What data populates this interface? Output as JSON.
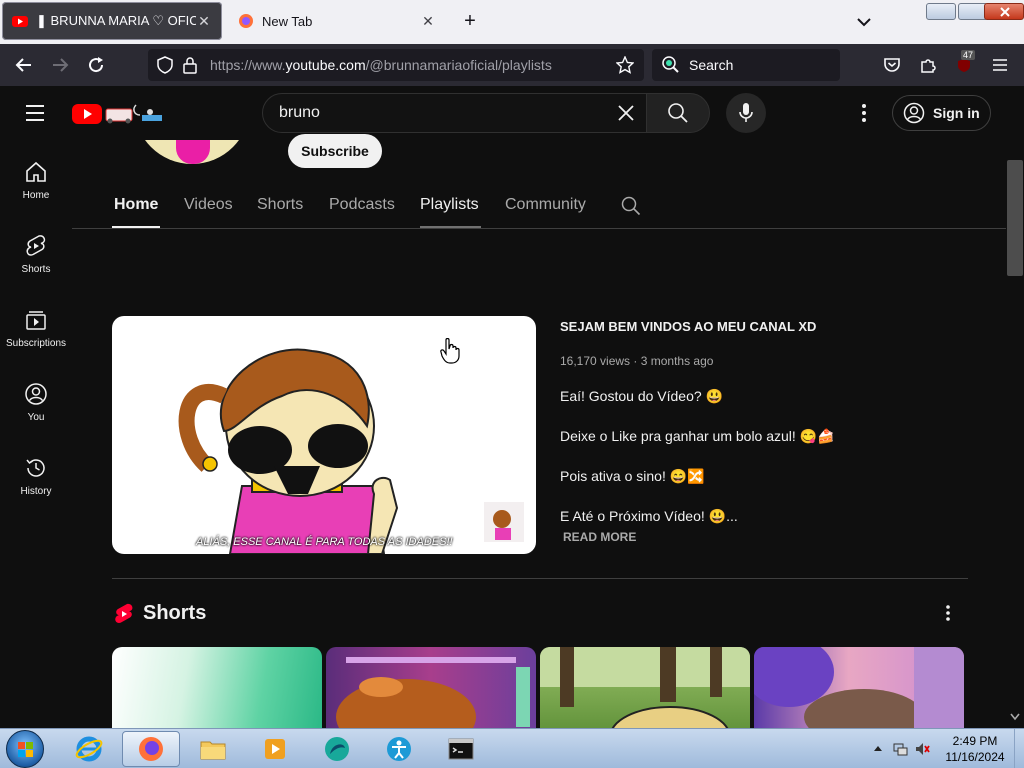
{
  "browser": {
    "tabs": [
      {
        "title": "❚ BRUNNA MARIA ♡ OFICIAL",
        "active": true
      },
      {
        "title": "New Tab",
        "active": false
      }
    ],
    "address": {
      "prefix": "https://www.",
      "host": "youtube.com",
      "path": "/@brunnamariaoficial/playlists"
    },
    "search_placeholder": "Search",
    "extension_badge": "47"
  },
  "youtube": {
    "search_value": "bruno",
    "sign_in_label": "Sign in",
    "sidebar": [
      {
        "label": "Home",
        "icon": "home-icon"
      },
      {
        "label": "Shorts",
        "icon": "shorts-icon"
      },
      {
        "label": "Subscriptions",
        "icon": "subscriptions-icon"
      },
      {
        "label": "You",
        "icon": "you-icon"
      },
      {
        "label": "History",
        "icon": "history-icon"
      }
    ],
    "subscribe_label": "Subscribe",
    "channel_tabs": [
      "Home",
      "Videos",
      "Shorts",
      "Podcasts",
      "Playlists",
      "Community"
    ],
    "featured": {
      "title": "SEJAM BEM VINDOS AO MEU CANAL XD",
      "views": "16,170 views",
      "age": "3 months ago",
      "description": [
        "Eaí! Gostou do Vídeo? 😃",
        "Deixe o Like pra ganhar um bolo azul! 😋🍰",
        "Pois ativa o sino! 😄🔀",
        "E Até o Próximo Vídeo! 😃..."
      ],
      "read_more": "READ MORE",
      "thumbnail_caption": "ALIÁS, ESSE CANAL É PARA TODAS AS IDADES!!"
    },
    "shorts_title": "Shorts"
  },
  "taskbar": {
    "time": "2:49 PM",
    "date": "11/16/2024"
  },
  "colors": {
    "yt_red": "#ff0000",
    "yt_bg": "#0f0f0f",
    "firefox_dark": "#2b2a33"
  }
}
